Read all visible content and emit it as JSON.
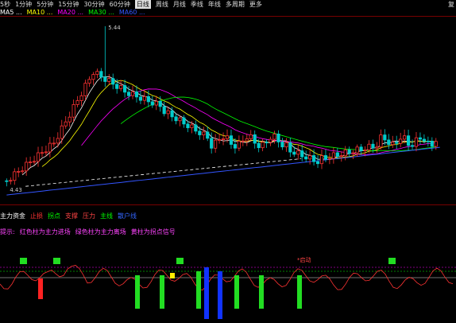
{
  "toolbar": {
    "periods": [
      "5秒",
      "1分钟",
      "5分钟",
      "15分钟",
      "30分钟",
      "60分钟",
      "日线",
      "周线",
      "月线",
      "季线",
      "年线",
      "多周期",
      "更多"
    ],
    "active_index": 6,
    "right_label": "复"
  },
  "ma_legend": [
    {
      "label": "MA5 ...",
      "color": "#ffffff"
    },
    {
      "label": "MA10 ...",
      "color": "#ffff00"
    },
    {
      "label": "MA20 ...",
      "color": "#ff00ff"
    },
    {
      "label": "MA30 ...",
      "color": "#00ff00"
    },
    {
      "label": "MA60 ...",
      "color": "#3355ff"
    }
  ],
  "price_high_label": "5.44",
  "price_low_label": "4.43",
  "sub_header": [
    {
      "label": "主力资金",
      "color": "#ffffff"
    },
    {
      "label": "止损",
      "color": "#ff3333"
    },
    {
      "label": "拐点",
      "color": "#00ff00"
    },
    {
      "label": "支撑",
      "color": "#ff4444"
    },
    {
      "label": "压力",
      "color": "#ff4444"
    },
    {
      "label": "主线",
      "color": "#00ff00"
    },
    {
      "label": "散户线",
      "color": "#3366ff"
    }
  ],
  "notes": [
    {
      "label": "提示:",
      "color": "#ff44ff"
    },
    {
      "label": "红色柱为主力进场",
      "color": "#ff44ff"
    },
    {
      "label": "绿色柱为主力离场",
      "color": "#ff44ff"
    },
    {
      "label": "黄柱为拐点信号",
      "color": "#ff44ff"
    }
  ],
  "signal_label": "*启动",
  "colors": {
    "up": "#ff3333",
    "down": "#00cccc",
    "ma5": "#ffffff",
    "ma10": "#ffff00",
    "ma20": "#ff00ff",
    "ma30": "#00ff00",
    "ma60": "#3355ff"
  }
}
